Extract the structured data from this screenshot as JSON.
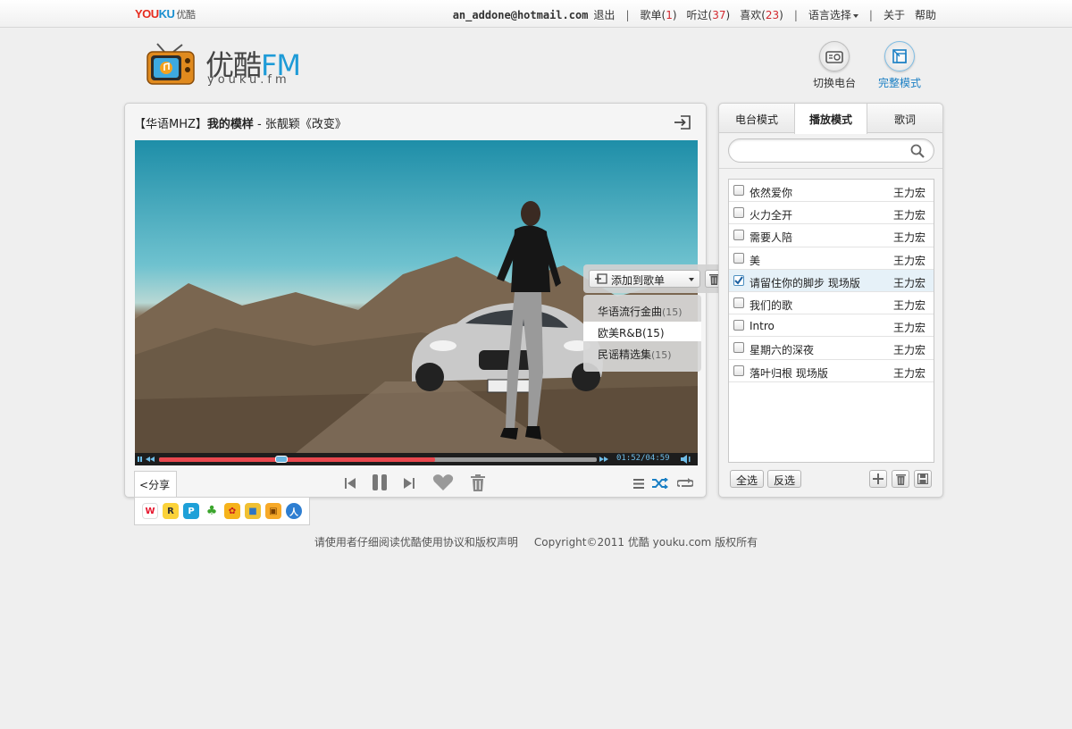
{
  "topbar": {
    "logo_you": "YOU",
    "logo_ku": "KU",
    "logo_cn": "优酷",
    "email": "an_addone@hotmail.com",
    "logout": "退出",
    "playlist_label": "歌单",
    "playlist_count": "1",
    "heard_label": "听过",
    "heard_count": "37",
    "liked_label": "喜欢",
    "liked_count": "23",
    "language": "语言选择",
    "about": "关于",
    "help": "帮助"
  },
  "brand": {
    "title_cn": "优酷",
    "title_fm": "FM",
    "subtitle": "youku.fm"
  },
  "modes": {
    "switch_station": "切换电台",
    "full_mode": "完整模式"
  },
  "player": {
    "station": "【华语MHZ】",
    "song": "我的模样",
    "sep": " - ",
    "artist_album": "张靓颖《改变》",
    "time": "01:52/04:59",
    "progress": 0.63,
    "share_label": "分享"
  },
  "add_popup": {
    "label": "添加到歌单",
    "options": [
      {
        "name": "华语流行金曲",
        "count": "(15)"
      },
      {
        "name": "欧美R&B",
        "count": "(15)"
      },
      {
        "name": "民谣精选集",
        "count": "(15)"
      }
    ]
  },
  "sidebar": {
    "tabs": [
      "电台模式",
      "播放模式",
      "歌词"
    ],
    "active_tab": 1,
    "search_placeholder": "",
    "songs": [
      {
        "title": "依然爱你",
        "artist": "王力宏",
        "checked": false
      },
      {
        "title": "火力全开",
        "artist": "王力宏",
        "checked": false
      },
      {
        "title": "需要人陪",
        "artist": "王力宏",
        "checked": false
      },
      {
        "title": "美",
        "artist": "王力宏",
        "checked": false
      },
      {
        "title": "请留住你的脚步 现场版",
        "artist": "王力宏",
        "checked": true
      },
      {
        "title": "我们的歌",
        "artist": "王力宏",
        "checked": false
      },
      {
        "title": "Intro",
        "artist": "王力宏",
        "checked": false
      },
      {
        "title": "星期六的深夜",
        "artist": "王力宏",
        "checked": false
      },
      {
        "title": "落叶归根 现场版",
        "artist": "王力宏",
        "checked": false
      }
    ],
    "select_all": "全选",
    "invert": "反选"
  },
  "footer": {
    "notice": "请使用者仔细阅读优酷使用协议和版权声明",
    "copyright": "Copyright©2011 优酷 youku.com 版权所有"
  },
  "colors": {
    "accent_blue": "#1e9bd7",
    "count_red": "#d2282e",
    "progress_red": "#e8484e"
  }
}
